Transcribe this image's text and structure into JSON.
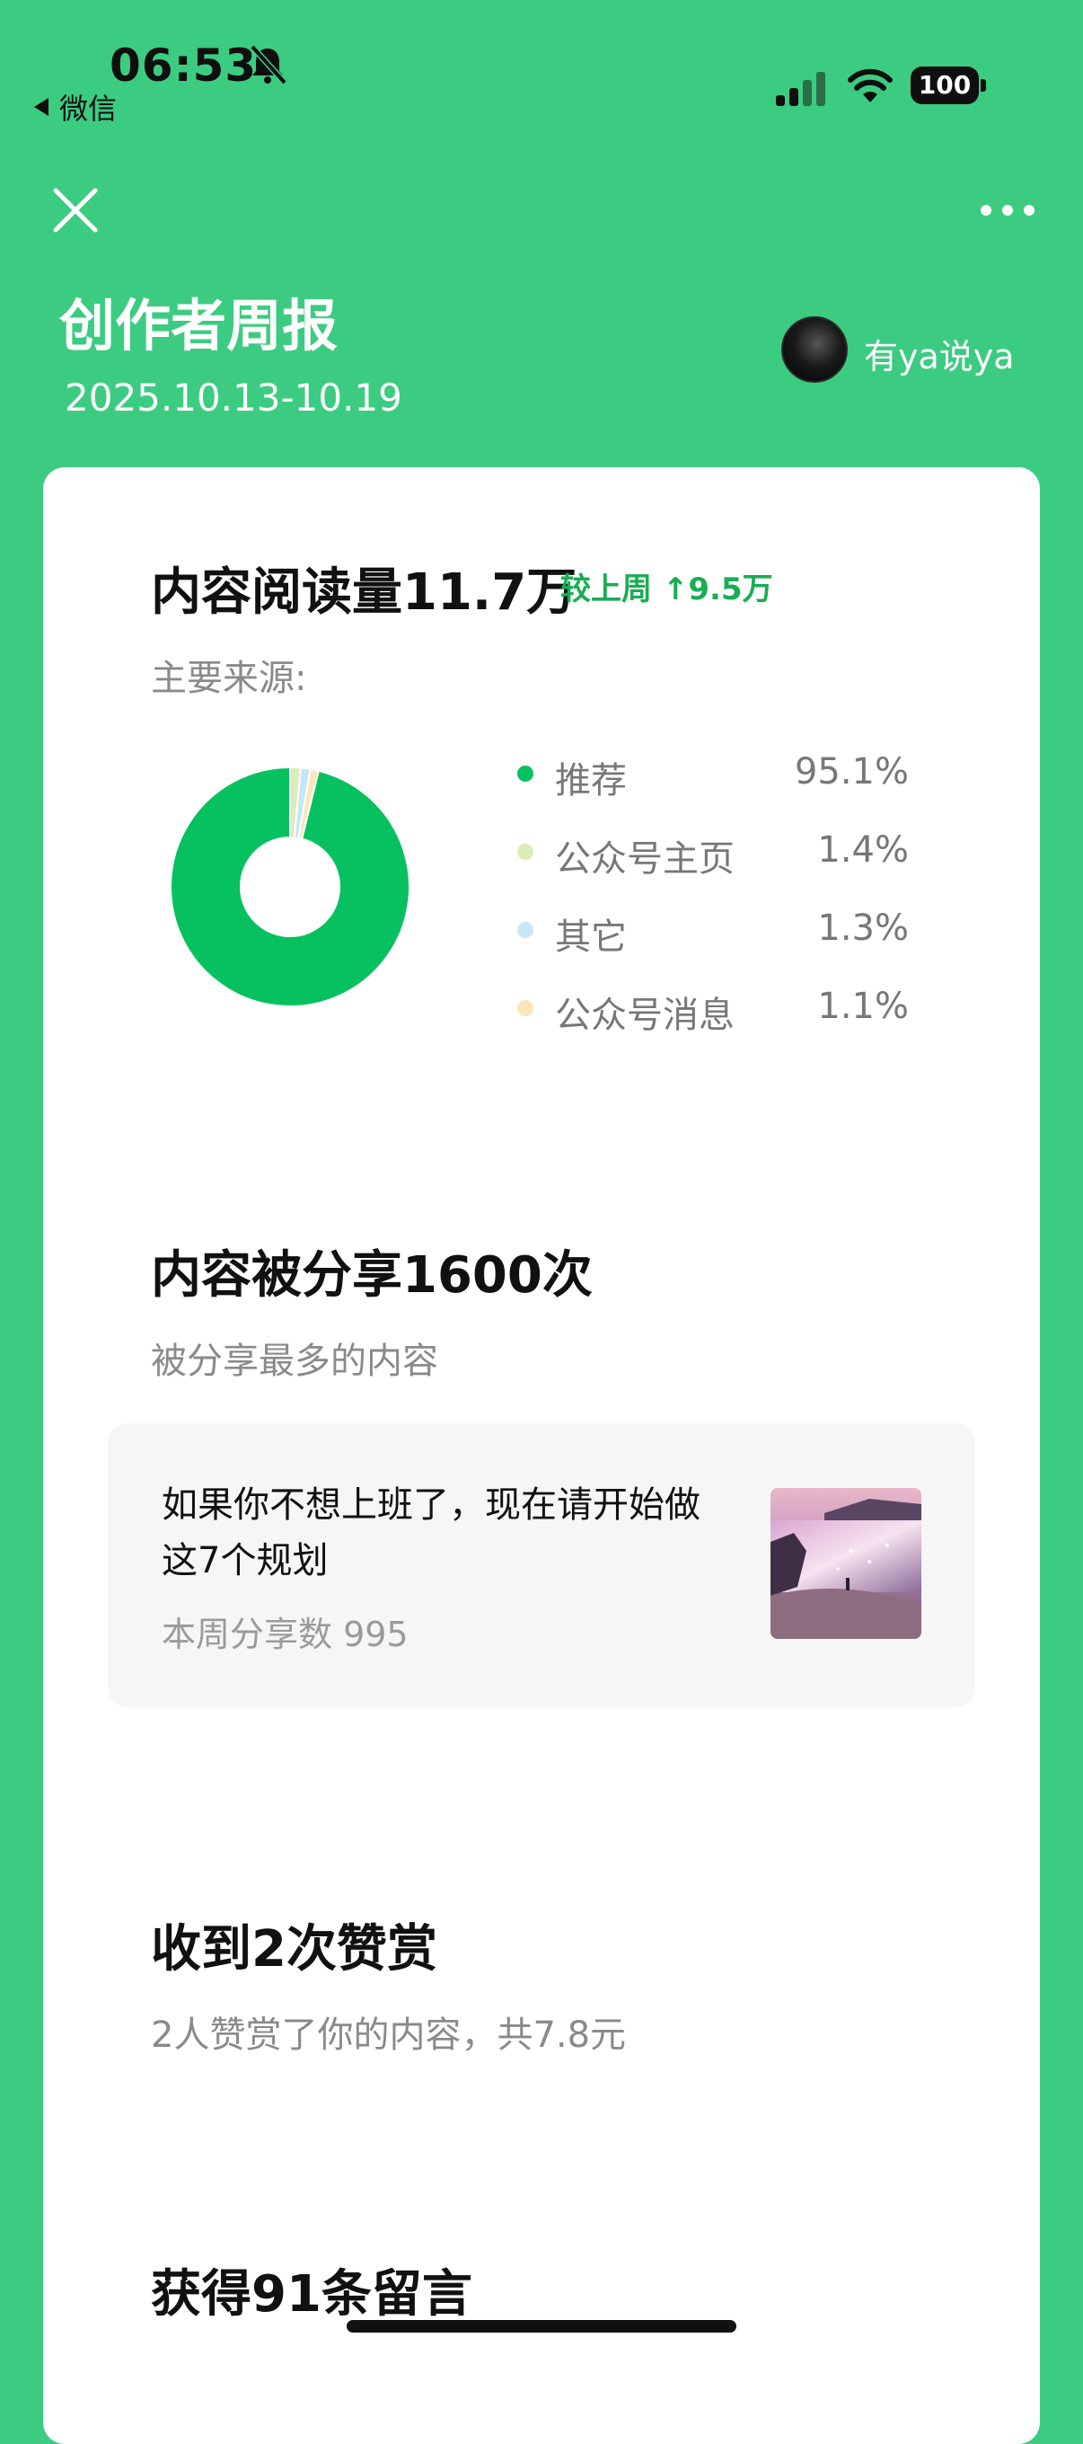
{
  "status_bar": {
    "time": "06:53",
    "back_app": "微信",
    "battery": "100"
  },
  "header": {
    "title": "创作者周报",
    "date_range": "2025.10.13-10.19",
    "author": "有ya说ya"
  },
  "reads": {
    "title": "内容阅读量11.7万",
    "compare": "较上周 ↑9.5万",
    "source_label": "主要来源:",
    "sources": [
      {
        "name": "推荐",
        "pct": "95.1%",
        "value": 95.1,
        "color": "#07c160"
      },
      {
        "name": "公众号主页",
        "pct": "1.4%",
        "value": 1.4,
        "color": "#d9efb5"
      },
      {
        "name": "其它",
        "pct": "1.3%",
        "value": 1.3,
        "color": "#c6e7f7"
      },
      {
        "name": "公众号消息",
        "pct": "1.1%",
        "value": 1.1,
        "color": "#fbe6b8"
      }
    ]
  },
  "shares": {
    "title": "内容被分享1600次",
    "subtitle": "被分享最多的内容",
    "top_article": {
      "title": "如果你不想上班了，现在请开始做这7个规划",
      "count": "本周分享数 995"
    }
  },
  "rewards": {
    "title": "收到2次赞赏",
    "subtitle": "2人赞赏了你的内容，共7.8元"
  },
  "comments": {
    "title": "获得91条留言"
  },
  "colors": {
    "background": "#3ccc81",
    "accent": "#07c160"
  }
}
